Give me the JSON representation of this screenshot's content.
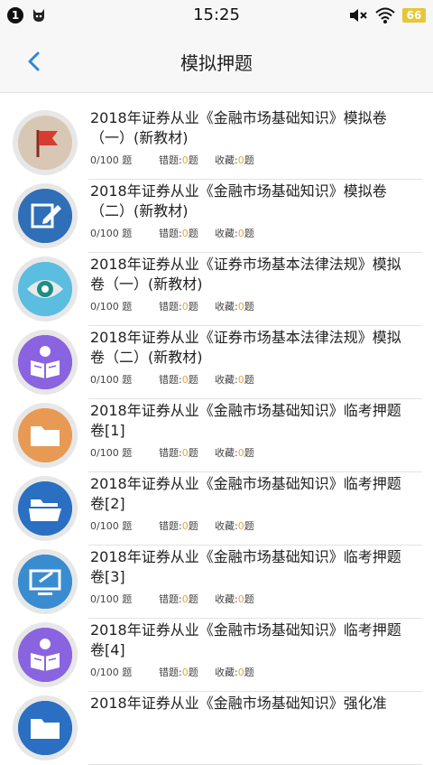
{
  "status_bar": {
    "notification_count": "1",
    "time": "15:25",
    "battery": "66"
  },
  "header": {
    "title": "模拟押题"
  },
  "items": [
    {
      "title": "2018年证券从业《金融市场基础知识》模拟卷（一）(新教材)",
      "progress": "0/100 题",
      "wrong_label": "错题:",
      "wrong": "0",
      "wrong_unit": "题",
      "fav_label": "收藏:",
      "fav": "0",
      "fav_unit": "题",
      "icon": "flag-icon",
      "color": "#d9c7b5"
    },
    {
      "title": "2018年证券从业《金融市场基础知识》模拟卷（二）(新教材)",
      "progress": "0/100 题",
      "wrong_label": "错题:",
      "wrong": "0",
      "wrong_unit": "题",
      "fav_label": "收藏:",
      "fav": "0",
      "fav_unit": "题",
      "icon": "edit-icon",
      "color": "#2f6fb8"
    },
    {
      "title": " 2018年证券从业《证券市场基本法律法规》模拟卷（一）(新教材)",
      "progress": "0/100 题",
      "wrong_label": "错题:",
      "wrong": "0",
      "wrong_unit": "题",
      "fav_label": "收藏:",
      "fav": "0",
      "fav_unit": "题",
      "icon": "eye-icon",
      "color": "#5bbde0"
    },
    {
      "title": "2018年证券从业《证券市场基本法律法规》模拟卷（二）(新教材)",
      "progress": "0/100 题",
      "wrong_label": "错题:",
      "wrong": "0",
      "wrong_unit": "题",
      "fav_label": "收藏:",
      "fav": "0",
      "fav_unit": "题",
      "icon": "reader-icon",
      "color": "#8a63e0"
    },
    {
      "title": "2018年证券从业《金融市场基础知识》临考押题卷[1]",
      "progress": "0/100 题",
      "wrong_label": "错题:",
      "wrong": "0",
      "wrong_unit": "题",
      "fav_label": "收藏:",
      "fav": "0",
      "fav_unit": "题",
      "icon": "folder-icon",
      "color": "#e89a55"
    },
    {
      "title": "2018年证券从业《金融市场基础知识》临考押题卷[2]",
      "progress": "0/100 题",
      "wrong_label": "错题:",
      "wrong": "0",
      "wrong_unit": "题",
      "fav_label": "收藏:",
      "fav": "0",
      "fav_unit": "题",
      "icon": "open-folder-icon",
      "color": "#2a6fc2"
    },
    {
      "title": "2018年证券从业《金融市场基础知识》临考押题卷[3]",
      "progress": "0/100 题",
      "wrong_label": "错题:",
      "wrong": "0",
      "wrong_unit": "题",
      "fav_label": "收藏:",
      "fav": "0",
      "fav_unit": "题",
      "icon": "monitor-icon",
      "color": "#3a8cd0"
    },
    {
      "title": "2018年证券从业《金融市场基础知识》临考押题卷[4]",
      "progress": "0/100 题",
      "wrong_label": "错题:",
      "wrong": "0",
      "wrong_unit": "题",
      "fav_label": "收藏:",
      "fav": "0",
      "fav_unit": "题",
      "icon": "reader-icon",
      "color": "#8a63e0"
    },
    {
      "title": "2018年证券从业《金融市场基础知识》强化准",
      "progress": "",
      "wrong_label": "",
      "wrong": "",
      "wrong_unit": "",
      "fav_label": "",
      "fav": "",
      "fav_unit": "",
      "icon": "folder-icon",
      "color": "#2a6fc2"
    }
  ]
}
